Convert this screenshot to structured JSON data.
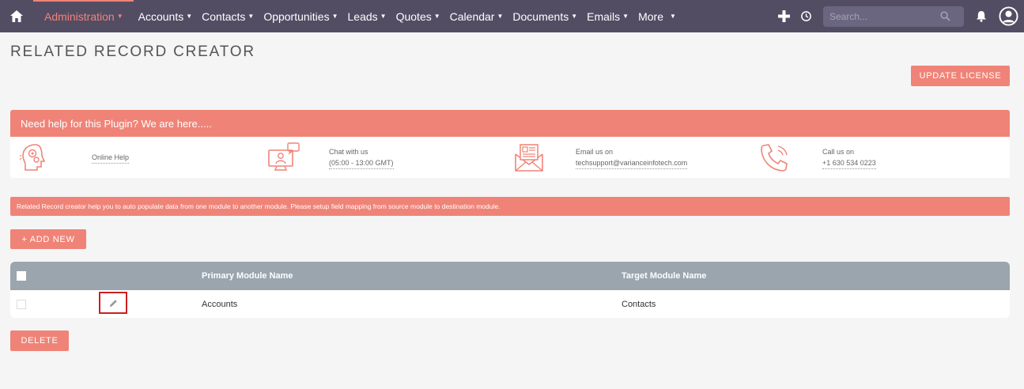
{
  "nav": {
    "items": [
      {
        "label": "Administration",
        "active": true
      },
      {
        "label": "Accounts"
      },
      {
        "label": "Contacts"
      },
      {
        "label": "Opportunities"
      },
      {
        "label": "Leads"
      },
      {
        "label": "Quotes"
      },
      {
        "label": "Calendar"
      },
      {
        "label": "Documents"
      },
      {
        "label": "Emails"
      },
      {
        "label": "More"
      }
    ],
    "search_placeholder": "Search...",
    "icons": [
      "home-icon",
      "plus-icon",
      "history-icon",
      "search-icon",
      "bell-icon",
      "user-icon"
    ]
  },
  "page": {
    "title": "RELATED RECORD CREATOR",
    "update_license": "UPDATE LICENSE"
  },
  "help": {
    "heading": "Need help for this Plugin? We are here.....",
    "online_help": "Online Help",
    "chat_line1": "Chat with us",
    "chat_line2": "(05:00 - 13:00 GMT)",
    "email_line1": "Email us on",
    "email_line2": "techsupport@varianceinfotech.com",
    "call_line1": "Call us on",
    "call_line2": "+1 630 534 0223"
  },
  "info": "Related Record creator help you to auto populate data from one module to another module. Please setup field mapping from source module to destination module.",
  "buttons": {
    "add_new": "+ ADD NEW",
    "delete": "DELETE"
  },
  "table": {
    "headers": {
      "primary": "Primary Module Name",
      "target": "Target Module Name"
    },
    "rows": [
      {
        "primary": "Accounts",
        "target": "Contacts"
      }
    ]
  },
  "colors": {
    "accent": "#f08377",
    "nav_bg": "#534d64",
    "table_head": "#9aa5ad",
    "highlight": "#cc1f1f"
  }
}
